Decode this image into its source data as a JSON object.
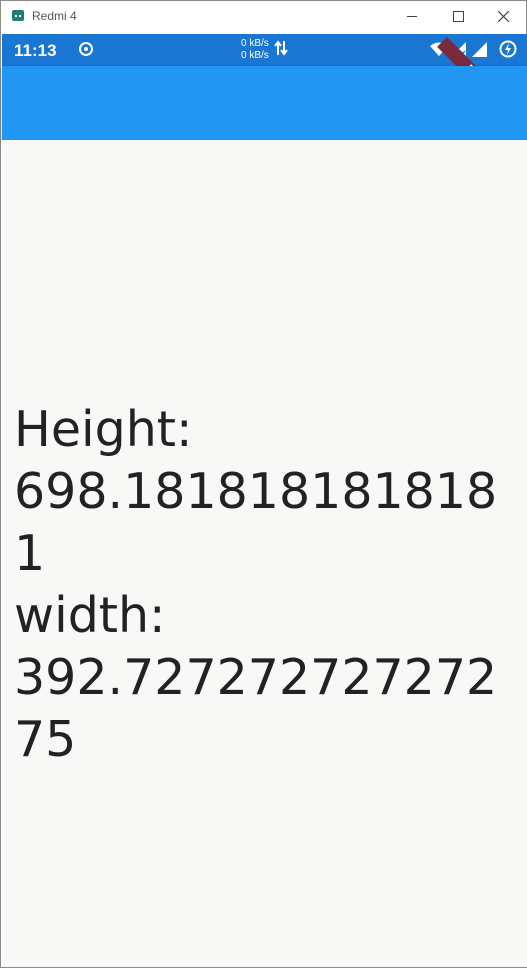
{
  "window": {
    "title": "Redmi 4"
  },
  "status_bar": {
    "time": "11:13",
    "upload_speed": "0 kB/s",
    "download_speed": "0 kB/s",
    "icons": [
      "record-icon",
      "data-transfer-arrows-icon",
      "wifi-icon",
      "cellular-signal-icon",
      "cellular-signal-no-data-icon",
      "battery-charging-icon"
    ]
  },
  "debug_banner": {
    "label": "DEBUG"
  },
  "app_bar": {
    "title": ""
  },
  "main": {
    "line1": "Height:",
    "line2": "698.1818181818181",
    "line3": "width:",
    "line4": "392.72727272727275"
  },
  "colors": {
    "status_bar": "#1976d2",
    "app_bar": "#2196f3",
    "background": "#f8f9f6",
    "text": "#222222",
    "debug_banner": "#7a2a3a"
  }
}
